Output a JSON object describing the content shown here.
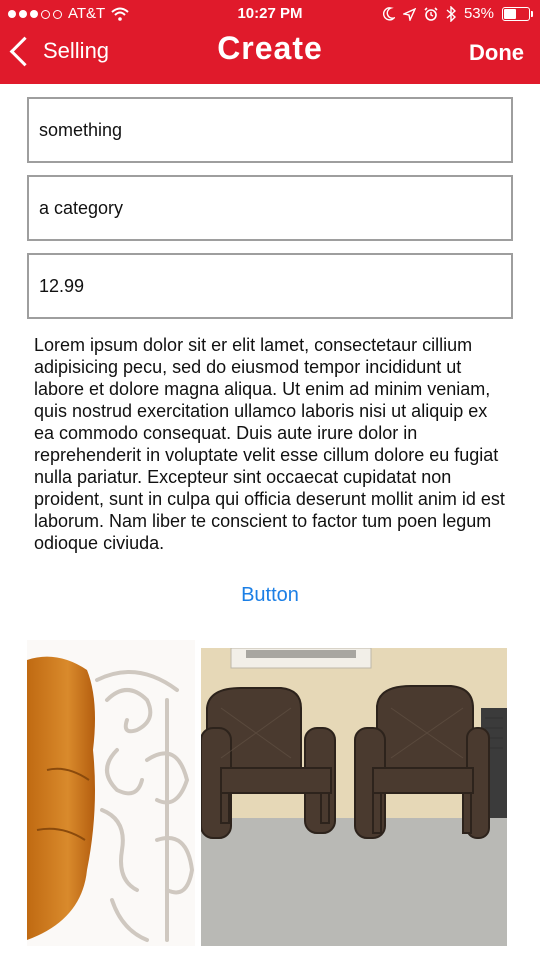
{
  "status_bar": {
    "carrier": "AT&T",
    "time": "10:27 PM",
    "battery_percent": "53%",
    "battery_level": 0.53,
    "icons": [
      "signal-dots-icon",
      "wifi-icon",
      "moon-icon",
      "location-icon",
      "alarm-icon",
      "bluetooth-icon",
      "battery-icon"
    ]
  },
  "nav": {
    "back_label": "Selling",
    "title": "Create",
    "done_label": "Done"
  },
  "form": {
    "title_value": "something",
    "category_value": "a category",
    "price_value": "12.99"
  },
  "description": "Lorem ipsum dolor sit er elit lamet, consectetaur cillium adipisicing pecu, sed do eiusmod tempor incididunt ut labore et dolore magna aliqua. Ut enim ad minim veniam, quis nostrud exercitation ullamco laboris nisi ut aliquip ex ea commodo consequat. Duis aute irure dolor in reprehenderit in voluptate velit esse cillum dolore eu fugiat nulla pariatur. Excepteur sint occaecat cupidatat non proident, sunt in culpa qui officia deserunt mollit anim id est laborum. Nam liber te conscient to factor tum poen legum odioque civiuda.",
  "action_button_label": "Button",
  "colors": {
    "header": "#e01a2b",
    "link": "#1b7fe6",
    "field_border": "#9e9e9e"
  },
  "photos": [
    "cushioned-metal-chair-photo",
    "wicker-chairs-photo"
  ]
}
